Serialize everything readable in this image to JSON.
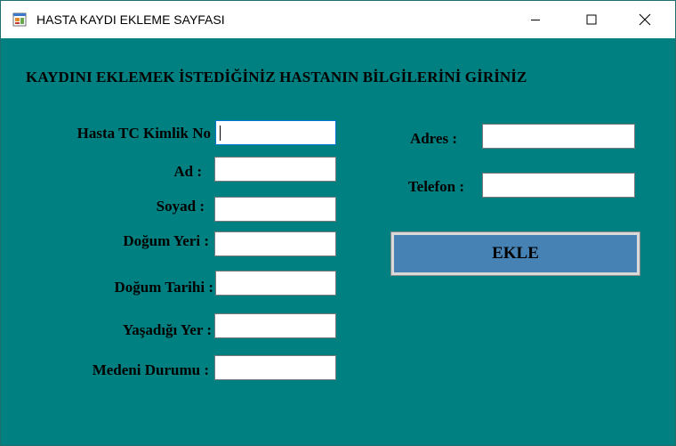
{
  "window": {
    "title": "HASTA KAYDI EKLEME SAYFASI",
    "controls": {
      "minimize_icon": "minimize-icon",
      "maximize_icon": "maximize-icon",
      "close_icon": "close-icon"
    },
    "background_color": "#008080"
  },
  "form": {
    "heading": "KAYDINI EKLEMEK İSTEDİĞİNİZ HASTANIN BİLGİLERİNİ GİRİNİZ",
    "left_fields": [
      {
        "label": "Hasta TC Kimlik No",
        "value": ""
      },
      {
        "label": "Ad :",
        "value": ""
      },
      {
        "label": "Soyad :",
        "value": ""
      },
      {
        "label": "Doğum Yeri :",
        "value": ""
      },
      {
        "label": "Doğum Tarihi :",
        "value": ""
      },
      {
        "label": "Yaşadığı Yer :",
        "value": ""
      },
      {
        "label": "Medeni Durumu :",
        "value": ""
      }
    ],
    "right_fields": [
      {
        "label": "Adres :",
        "value": ""
      },
      {
        "label": "Telefon :",
        "value": ""
      }
    ],
    "submit_label": "EKLE",
    "submit_color": "#4682b4"
  }
}
